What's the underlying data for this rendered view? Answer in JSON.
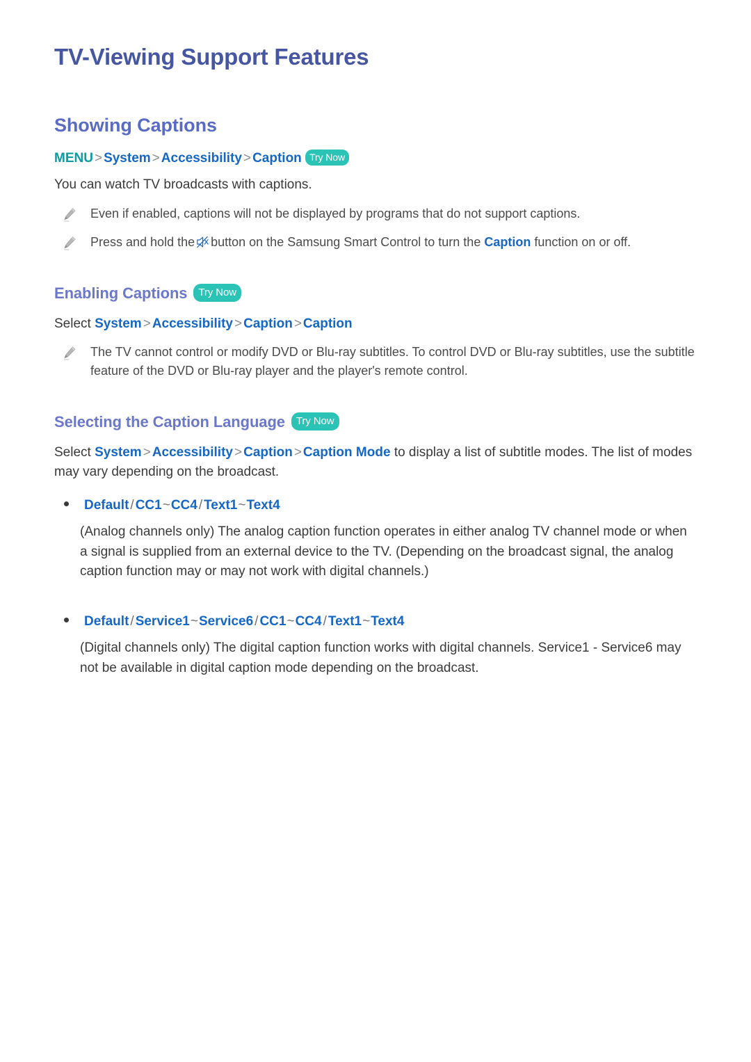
{
  "page": {
    "title": "TV-Viewing Support Features"
  },
  "sections": [
    {
      "heading": "Showing Captions",
      "menu_path": {
        "root": "MENU",
        "items": [
          "System",
          "Accessibility",
          "Caption"
        ],
        "separator": ">",
        "badge": "Try Now"
      },
      "intro": "You can watch TV broadcasts with captions.",
      "notes": [
        {
          "icon": "pencil-icon",
          "text_before": "Even if enabled, captions will not be displayed by programs that do not support captions.",
          "has_speaker_icon": false
        },
        {
          "icon": "pencil-icon",
          "has_speaker_icon": true,
          "speaker_icon": "mute-speaker-icon",
          "text_before": "Press and hold the",
          "text_mid": "button on the Samsung Smart Control to turn the",
          "keyword": "Caption",
          "text_after": "function on or off."
        }
      ]
    },
    {
      "heading": "Enabling Captions",
      "badge": "Try Now",
      "select_path": {
        "prefix": "Select",
        "items": [
          "System",
          "Accessibility",
          "Caption",
          "Caption"
        ],
        "separator": ">"
      },
      "notes": [
        {
          "icon": "pencil-icon",
          "text_before": "The TV cannot control or modify DVD or Blu-ray subtitles. To control DVD or Blu-ray subtitles, use the subtitle feature of the DVD or Blu-ray player and the player's remote control."
        }
      ]
    },
    {
      "heading": "Selecting the Caption Language",
      "badge": "Try Now",
      "select_path": {
        "prefix": "Select",
        "items": [
          "System",
          "Accessibility",
          "Caption",
          "Caption Mode"
        ],
        "separator": ">",
        "suffix": "to display a list of subtitle modes. The list of modes may vary depending on the broadcast."
      },
      "mode_lists": [
        {
          "options": "Default / CC1 ~ CC4 / Text1 ~ Text4",
          "description": "(Analog channels only) The analog caption function operates in either analog TV channel mode or when a signal is supplied from an external device to the TV. (Depending on the broadcast signal, the analog caption function may or may not work with digital channels.)"
        },
        {
          "options": "Default / Service1 ~ Service6 / CC1 ~ CC4 / Text1 ~ Text4",
          "description": "(Digital channels only) The digital caption function works with digital channels. Service1 - Service6 may not be available in digital caption mode depending on the broadcast."
        }
      ]
    }
  ],
  "colors": {
    "title_blue": "#4656a0",
    "heading_blue": "#5a6bc4",
    "subheading_blue": "#6b78c9",
    "link_blue": "#1667c4",
    "menu_teal": "#0c9ba2",
    "badge_teal": "#2cc3b7",
    "body_gray": "#3a3a3a"
  }
}
